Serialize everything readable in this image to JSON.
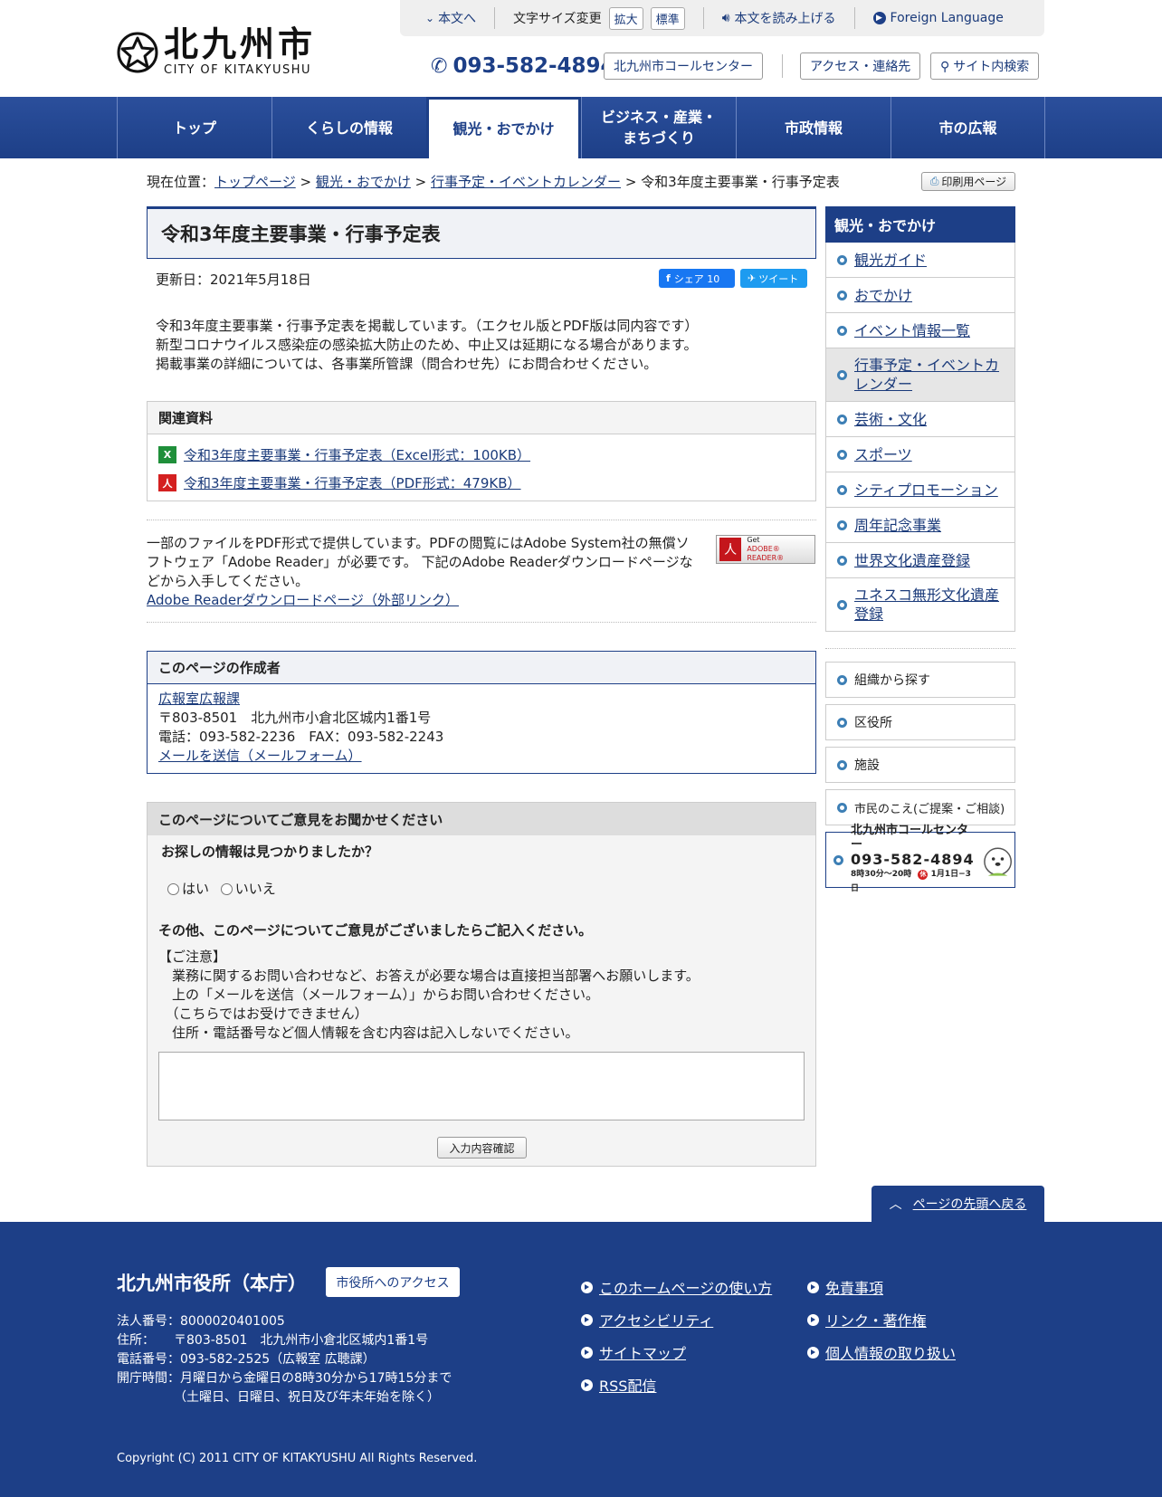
{
  "header": {
    "logo_jp": "北九州市",
    "logo_en": "CITY OF KITAKYUSHU",
    "skip": "本文へ",
    "font_size_label": "文字サイズ変更",
    "font_large": "拡大",
    "font_standard": "標準",
    "read_aloud": "本文を読み上げる",
    "foreign": "Foreign Language",
    "phone": "093-582-4894",
    "call_center": "北九州市コールセンター",
    "access": "アクセス・連絡先",
    "search": "サイト内検索"
  },
  "nav": [
    {
      "label": "トップ"
    },
    {
      "label": "くらしの情報"
    },
    {
      "label": "観光・おでかけ"
    },
    {
      "label": "ビジネス・産業・まちづくり"
    },
    {
      "label": "市政情報"
    },
    {
      "label": "市の広報"
    }
  ],
  "breadcrumb": {
    "prefix": "現在位置：",
    "items": [
      "トップページ",
      "観光・おでかけ",
      "行事予定・イベントカレンダー"
    ],
    "current": "令和3年度主要事業・行事予定表",
    "sep": ">"
  },
  "print_label": "印刷用ページ",
  "page": {
    "title": "令和3年度主要事業・行事予定表",
    "updated": "更新日：2021年5月18日",
    "share_fb": "シェア 10",
    "share_tw": "ツイート",
    "intro": [
      "令和3年度主要事業・行事予定表を掲載しています。（エクセル版とPDF版は同内容です）",
      "新型コロナウイルス感染症の感染拡大防止のため、中止又は延期になる場合があります。",
      "掲載事業の詳細については、各事業所管課（問合わせ先）にお問合わせください。"
    ]
  },
  "related": {
    "title": "関連資料",
    "files": [
      {
        "label": "令和3年度主要事業・行事予定表（Excel形式：100KB）",
        "icon": "excel-icon"
      },
      {
        "label": "令和3年度主要事業・行事予定表（PDF形式：479KB）",
        "icon": "pdf-icon"
      }
    ]
  },
  "pdf_note": {
    "text": "一部のファイルをPDF形式で提供しています。PDFの閲覧にはAdobe System社の無償ソフトウェア「Adobe Reader」が必要です。 下記のAdobe Readerダウンロードページなどから入手してください。",
    "link": "Adobe Readerダウンロードページ（外部リンク）",
    "badge_line1": "Get",
    "badge_line2": "ADOBE® READER®"
  },
  "author": {
    "title": "このページの作成者",
    "dept": "広報室広報課",
    "address": "〒803-8501　北九州市小倉北区城内1番1号",
    "tel": "電話：093-582-2236　FAX：093-582-2243",
    "mail": "メールを送信（メールフォーム）"
  },
  "feedback": {
    "title": "このページについてご意見をお聞かせください",
    "q1": "お探しの情報は見つかりましたか？",
    "yes": "はい",
    "no": "いいえ",
    "q2": "その他、このページについてご意見がございましたらご記入ください。",
    "notes": [
      "【ご注意】",
      "　業務に関するお問い合わせなど、お答えが必要な場合は直接担当部署へお願いします。",
      "　上の「メールを送信（メールフォーム）」からお問い合わせください。",
      "　（こちらではお受けできません）",
      "　住所・電話番号など個人情報を含む内容は記入しないでください。"
    ],
    "submit": "入力内容確認"
  },
  "sidebar": {
    "title": "観光・おでかけ",
    "items": [
      {
        "label": "観光ガイド"
      },
      {
        "label": "おでかけ"
      },
      {
        "label": "イベント情報一覧"
      },
      {
        "label": "行事予定・イベントカレンダー"
      },
      {
        "label": "芸術・文化"
      },
      {
        "label": "スポーツ"
      },
      {
        "label": "シティプロモーション"
      },
      {
        "label": "周年記念事業"
      },
      {
        "label": "世界文化遺産登録"
      },
      {
        "label": "ユネスコ無形文化遺産登録"
      }
    ],
    "boxes": [
      "組織から探す",
      "区役所",
      "施設",
      "市民のこえ(ご提案・ご相談)"
    ],
    "callcenter": {
      "name": "北九州市コールセンター",
      "phone": "093-582-4894",
      "hours": "8時30分～20時",
      "closed": "休",
      "closed_days": "1月1日−3日"
    }
  },
  "to_top": "ページの先頭へ戻る",
  "footer": {
    "title": "北九州市役所（本庁）",
    "access": "市役所へのアクセス",
    "info": [
      "法人番号：8000020401005",
      "住所：　　〒803-8501　北九州市小倉北区城内1番1号",
      "電話番号：093-582-2525（広報室 広聴課）",
      "開庁時間：月曜日から金曜日の8時30分から17時15分まで",
      "　　　　　（土曜日、日曜日、祝日及び年末年始を除く）"
    ],
    "links_col1": [
      "このホームページの使い方",
      "アクセシビリティ",
      "サイトマップ",
      "RSS配信"
    ],
    "links_col2": [
      "免責事項",
      "リンク・著作権",
      "個人情報の取り扱い"
    ],
    "copyright": "Copyright (C) 2011 CITY OF KITAKYUSHU All Rights Reserved."
  },
  "colors": {
    "brand": "#1d3f87",
    "link": "#1a3a7a"
  }
}
